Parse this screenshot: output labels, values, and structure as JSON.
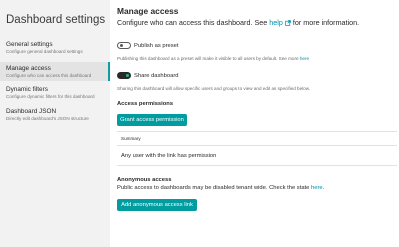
{
  "sidebar": {
    "title": "Dashboard settings",
    "items": [
      {
        "label": "General settings",
        "description": "Configure general dashboard settings"
      },
      {
        "label": "Manage access",
        "description": "Configure who can access this dashboard"
      },
      {
        "label": "Dynamic filters",
        "description": "Configure dynamic filters for this dashboard"
      },
      {
        "label": "Dashboard JSON",
        "description": "Directly edit dashboard's JSON structure"
      }
    ]
  },
  "main": {
    "title": "Manage access",
    "subtitle_before": "Configure who can access this dashboard. See ",
    "subtitle_link": "help",
    "subtitle_after": " for more information.",
    "publish": {
      "label": "Publish as preset",
      "enabled": false,
      "desc_before": "Publishing this dashboard as a preset will make it visible to all users by default. See more ",
      "desc_link": "here"
    },
    "share": {
      "label": "Share dashboard",
      "enabled": true,
      "desc": "Sharing this dashboard will allow specific users and groups to view and edit as specified below."
    },
    "access_permissions": {
      "heading": "Access permissions",
      "grant_button": "Grant access permission",
      "column_summary": "Summary",
      "row_summary": "Any user with the link has permission"
    },
    "anonymous_access": {
      "heading": "Anonymous access",
      "desc_before": "Public access to dashboards may be disabled tenant wide. Check the state ",
      "desc_link": "here",
      "desc_after": ".",
      "add_button": "Add anonymous access link"
    }
  },
  "colors": {
    "accent": "#009ca0",
    "link": "#008ea7",
    "sidebar_bg": "#f2f2f2",
    "toggle_on_knob": "#1abc9c"
  }
}
